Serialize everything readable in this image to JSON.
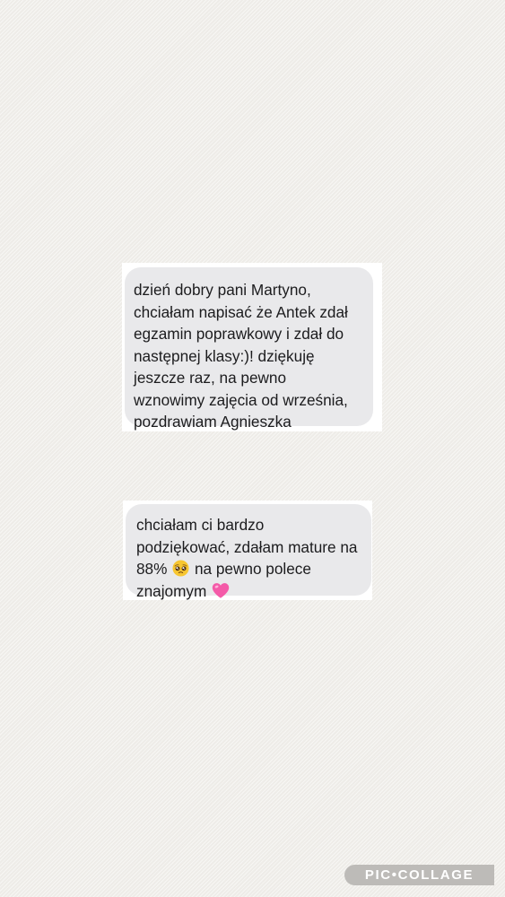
{
  "messages": [
    {
      "lines": [
        "dzień dobry pani Martyno,",
        "chciałam napisać że Antek zdał",
        "egzamin poprawkowy i zdał do",
        "następnej klasy:)! dziękuję",
        "jeszcze raz, na pewno",
        "wznowimy zajęcia od września,",
        "pozdrawiam Agnieszka"
      ]
    },
    {
      "lines": [
        "chciałam ci bardzo",
        "podziękować, zdałam mature na"
      ],
      "line3_before": "88%",
      "line3_after": "na pewno polece",
      "line4": "znajomym",
      "emojis": [
        "pleading-face",
        "pink-heart"
      ]
    }
  ],
  "watermark": "PIC•COLLAGE"
}
